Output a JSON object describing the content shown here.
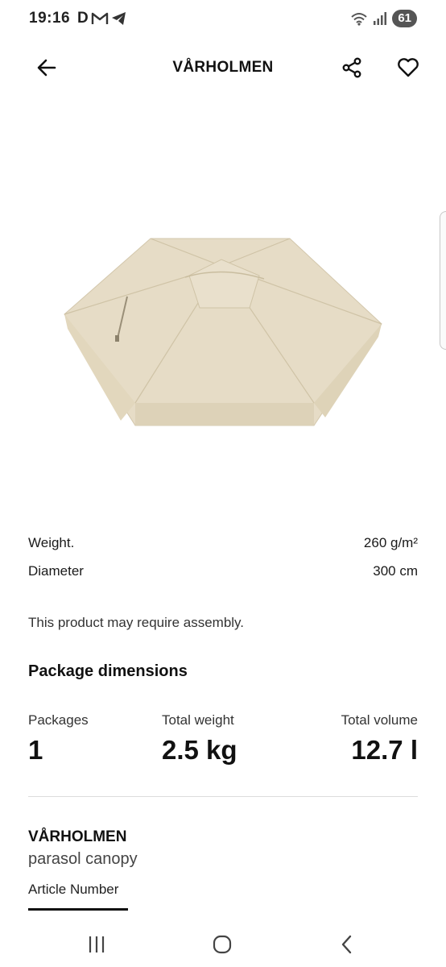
{
  "status_bar": {
    "time": "19:16",
    "notification_icons": [
      "d-app-icon",
      "gmail-icon",
      "telegram-icon"
    ],
    "notification_d": "D",
    "battery": "61"
  },
  "header": {
    "title": "VÅRHOLMEN",
    "back_icon": "arrow-left-icon",
    "share_icon": "share-icon",
    "favorite_icon": "heart-icon"
  },
  "specs": [
    {
      "label": "Weight.",
      "value": "260 g/m²"
    },
    {
      "label": "Diameter",
      "value": "300 cm"
    }
  ],
  "assembly_note": "This product may require assembly.",
  "package": {
    "heading": "Package dimensions",
    "packages_label": "Packages",
    "packages_value": "1",
    "weight_label": "Total weight",
    "weight_value": "2.5 kg",
    "volume_label": "Total volume",
    "volume_value": "12.7 l"
  },
  "product": {
    "name": "VÅRHOLMEN",
    "description": "parasol canopy",
    "article_tab": "Article Number"
  },
  "nav_bar": {
    "items": [
      "recents-icon",
      "home-icon",
      "back-icon"
    ]
  },
  "colors": {
    "canopy": "#e6dcc6",
    "accent": "#111111"
  }
}
